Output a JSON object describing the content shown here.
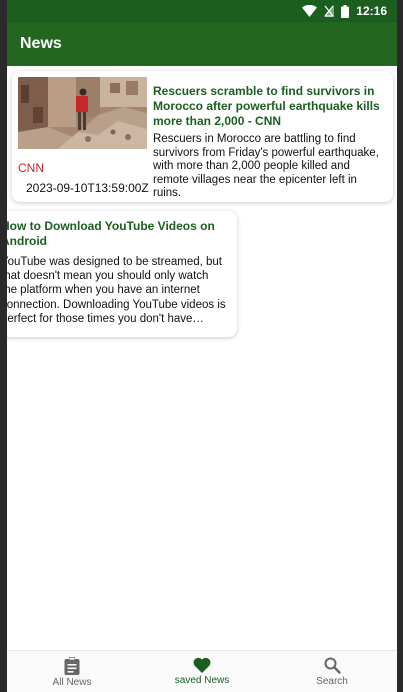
{
  "status_bar": {
    "time": "12:16",
    "icons": [
      "wifi-icon",
      "signal-icon",
      "battery-icon"
    ]
  },
  "app_bar": {
    "title": "News"
  },
  "articles": [
    {
      "title": "Rescuers scramble to find survivors in Morocco after powerful earthquake kills more than 2,000 - CNN",
      "description": "Rescuers in Morocco are battling to find survivors from Friday's powerful earthquake, with more than 2,000 people killed and remote villages near the epicenter left in ruins.",
      "source": "CNN",
      "published_at": "2023-09-10T13:59:00Z"
    },
    {
      "title": "How to Download YouTube Videos on Android",
      "description": "YouTube was designed to be streamed, but that doesn't mean you should only watch the platform when you have an internet connection. Downloading YouTube videos is perfect for those times you don't have servic…"
    }
  ],
  "bottom_nav": {
    "items": [
      {
        "label": "All News",
        "icon": "clipboard-icon",
        "active": false
      },
      {
        "label": "saved News",
        "icon": "heart-icon",
        "active": true
      },
      {
        "label": "Search",
        "icon": "search-icon",
        "active": false
      }
    ]
  },
  "colors": {
    "primary": "#23661f",
    "primary_dark": "#1b5e20",
    "source_red": "#c62828"
  }
}
